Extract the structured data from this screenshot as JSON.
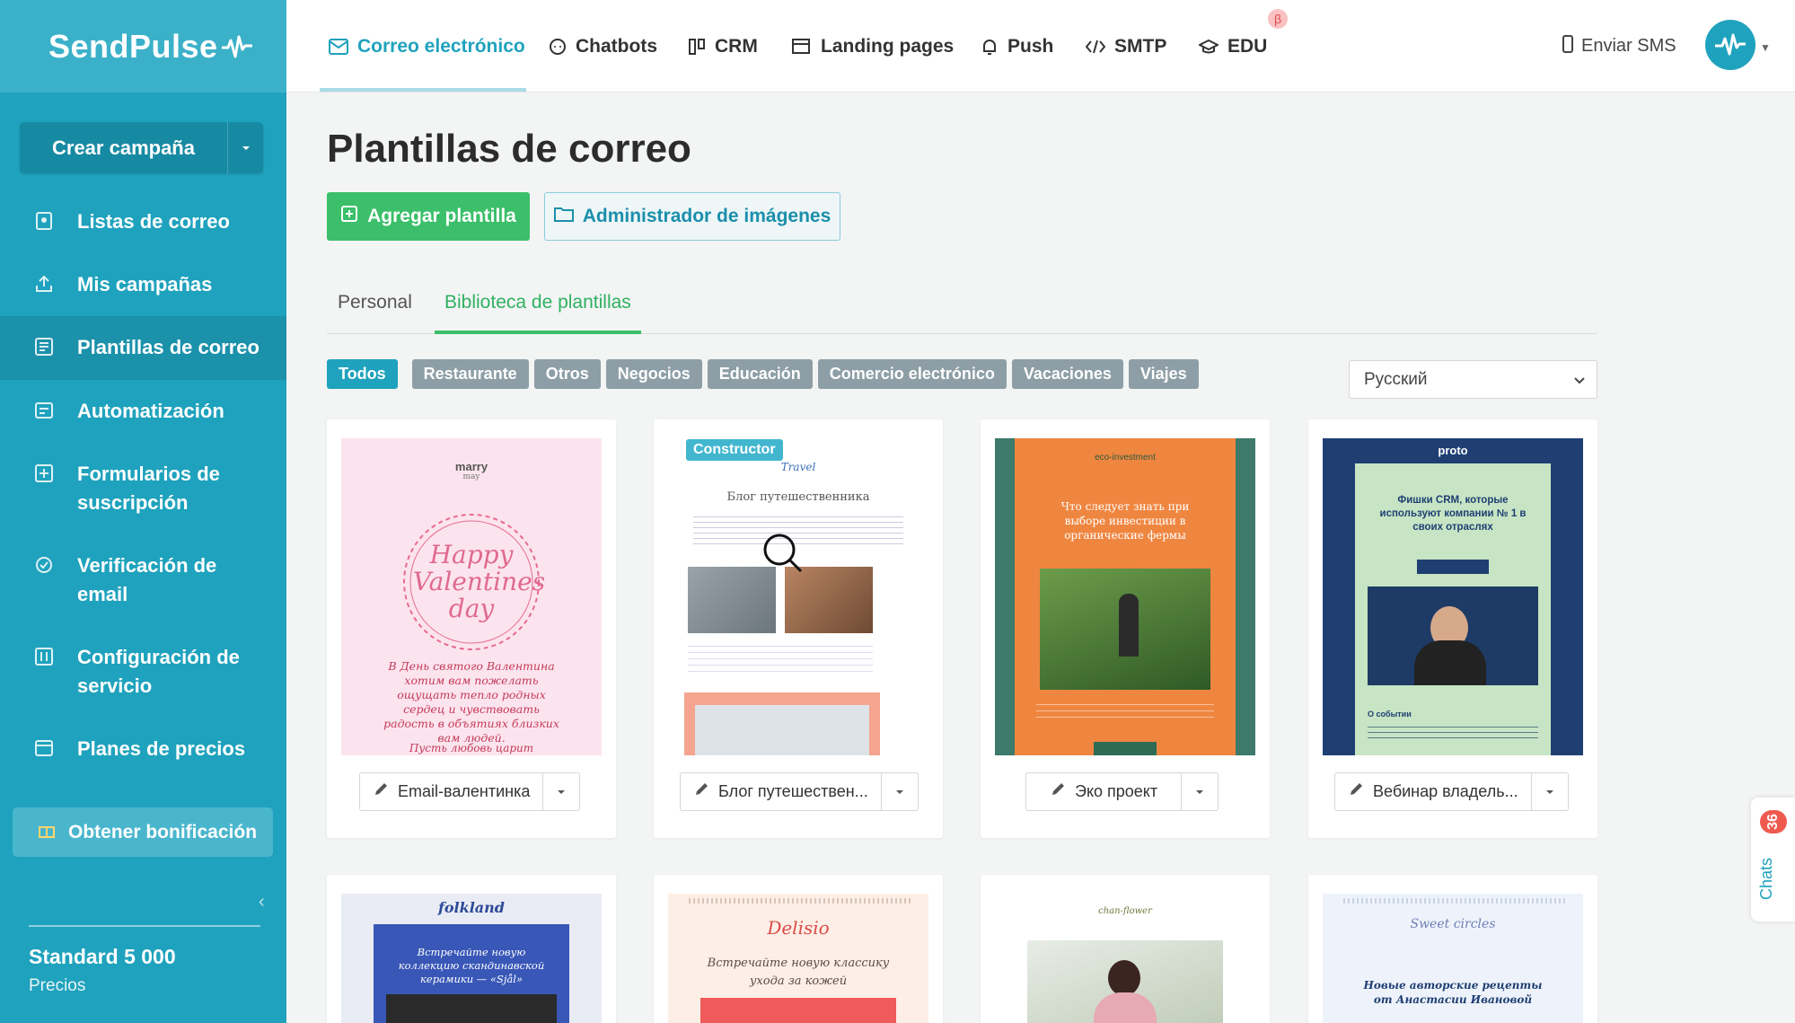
{
  "sidebar": {
    "logo": "SendPulse",
    "create_label": "Crear campaña",
    "items": [
      {
        "label": "Listas de correo",
        "icon": "list-icon"
      },
      {
        "label": "Mis campañas",
        "icon": "campaigns-icon"
      },
      {
        "label": "Plantillas de correo",
        "icon": "templates-icon"
      },
      {
        "label": "Automatización",
        "icon": "automation-icon"
      },
      {
        "label": "Formularios de suscripción",
        "icon": "form-icon"
      },
      {
        "label": "Verificación de email",
        "icon": "check-icon"
      },
      {
        "label": "Configuración de servicio",
        "icon": "settings-icon"
      },
      {
        "label": "Planes de precios",
        "icon": "pricing-icon"
      }
    ],
    "active_item": "Plantillas de correo",
    "bonus_label": "Obtener bonificación",
    "plan_name": "Standard 5 000",
    "plan_link": "Precios"
  },
  "topnav": {
    "items": [
      {
        "label": "Correo electrónico"
      },
      {
        "label": "Chatbots"
      },
      {
        "label": "CRM"
      },
      {
        "label": "Landing pages"
      },
      {
        "label": "Push"
      },
      {
        "label": "SMTP"
      },
      {
        "label": "EDU"
      }
    ],
    "beta": "β",
    "sms_label": "Enviar SMS"
  },
  "main": {
    "title": "Plantillas de correo",
    "add_label": "Agregar plantilla",
    "images_label": "Administrador de imágenes",
    "tabs": [
      "Personal",
      "Biblioteca de plantillas"
    ],
    "filters": [
      "Todos",
      "Restaurante",
      "Otros",
      "Negocios",
      "Educación",
      "Comercio electrónico",
      "Vacaciones",
      "Viajes"
    ],
    "language": "Русский"
  },
  "templates": [
    {
      "name": "Email-валентинка"
    },
    {
      "name": "Блог путешествен...",
      "badge": "Constructor"
    },
    {
      "name": "Эко проект"
    },
    {
      "name": "Вебинар владель..."
    }
  ],
  "thumbs": {
    "t1_brand": "marry",
    "t1_brand2": "may",
    "t1_title": "Happy Valentines day",
    "t1_text": "В День святого Валентина хотим вам пожелать ощущать тепло родных сердец и чувствовать радость в объятиях близких вам людей.",
    "t1_footer": "Пусть любовь царит",
    "t2_brand": "Travel",
    "t2_title": "Блог путешественника",
    "t3_brand": "eco-investment",
    "t3_title": "Что следует знать при выборе инвестиции в органические фермы",
    "t4_brand": "proto",
    "t4_title": "Фишки CRM, которые используют компании № 1 в своих отраслях",
    "t4_section": "О событии",
    "t5_brand": "folkland",
    "t5_text": "Встречайте новую коллекцию скандинавской керамики — «Sjål»",
    "t6_brand": "Delisio",
    "t6_text": "Встречайте новую классику ухода за кожей",
    "t7_brand": "chan-flower",
    "t8_brand": "Sweet circles",
    "t8_text": "Новые авторские рецепты от Анастасии Ивановой"
  },
  "chats": {
    "label": "Chats",
    "count": "36"
  },
  "colors": {
    "accent": "#1fa2bd",
    "green": "#3bbf6a",
    "chip": "#8d9ea6"
  }
}
